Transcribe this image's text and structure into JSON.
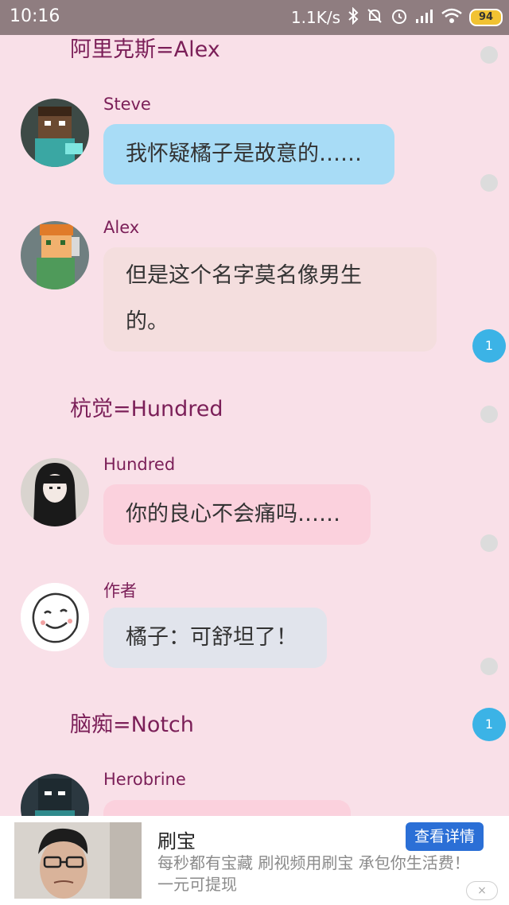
{
  "status_bar": {
    "time": "10:16",
    "network_speed": "1.1K/s",
    "battery": "94",
    "icons": [
      "bluetooth-icon",
      "mute-icon",
      "alarm-icon",
      "signal-icon",
      "wifi-icon",
      "battery-icon"
    ]
  },
  "chat": {
    "sections": [
      {
        "title": "阿里克斯=Alex"
      },
      {
        "title": "杭觉=Hundred"
      },
      {
        "title": "脑痴=Notch"
      }
    ],
    "messages": [
      {
        "sender": "Steve",
        "text": "我怀疑橘子是故意的……",
        "bubble_color": "#a8dcf6"
      },
      {
        "sender": "Alex",
        "text_line1": "但是这个名字莫名像男生",
        "text_line2": "的。",
        "bubble_color": "#f4dede"
      },
      {
        "sender": "Hundred",
        "text": "你的良心不会痛吗……",
        "bubble_color": "#fbd1dd"
      },
      {
        "sender": "作者",
        "text": "橘子：可舒坦了！",
        "bubble_color": "#e1e4ec"
      },
      {
        "sender": "Herobrine",
        "text": "",
        "bubble_color": "#fbd1dd"
      }
    ],
    "badges": [
      "1",
      "1"
    ],
    "accent_color": "#7b1f58",
    "background_color": "#f9e0e8"
  },
  "ad": {
    "title": "刷宝",
    "description": "每秒都有宝藏 刷视频用刷宝 承包你生活费！一元可提现",
    "button_label": "查看详情",
    "close_icon": "×"
  }
}
